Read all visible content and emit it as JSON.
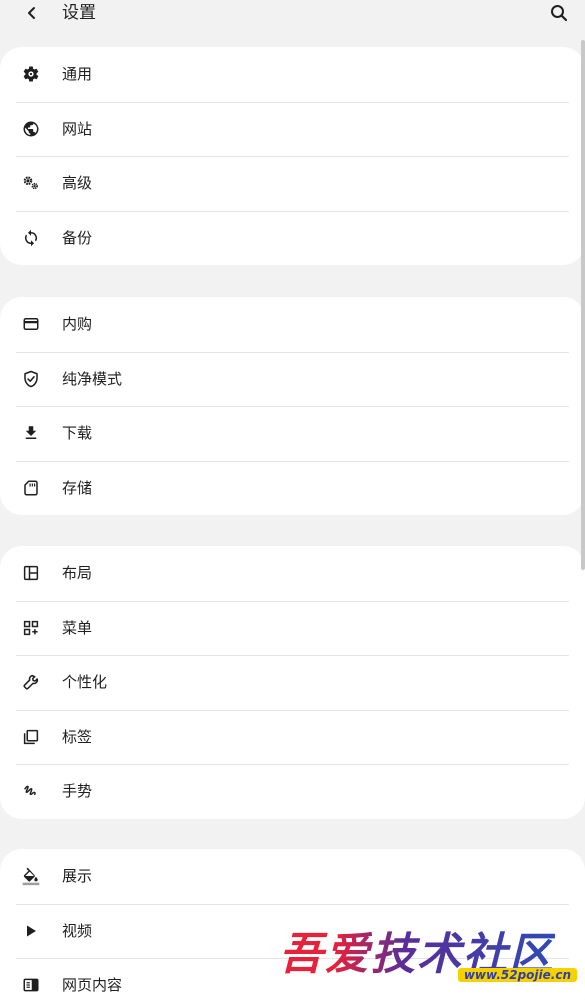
{
  "header": {
    "title": "设置"
  },
  "groups": [
    {
      "items": [
        {
          "label": "通用",
          "icon": "gear-icon"
        },
        {
          "label": "网站",
          "icon": "globe-icon"
        },
        {
          "label": "高级",
          "icon": "gears-icon"
        },
        {
          "label": "备份",
          "icon": "sync-icon"
        }
      ]
    },
    {
      "items": [
        {
          "label": "内购",
          "icon": "credit-card-icon"
        },
        {
          "label": "纯净模式",
          "icon": "shield-check-icon"
        },
        {
          "label": "下载",
          "icon": "download-icon"
        },
        {
          "label": "存储",
          "icon": "sd-card-icon"
        }
      ]
    },
    {
      "items": [
        {
          "label": "布局",
          "icon": "layout-icon"
        },
        {
          "label": "菜单",
          "icon": "add-grid-icon"
        },
        {
          "label": "个性化",
          "icon": "wrench-icon"
        },
        {
          "label": "标签",
          "icon": "tabs-icon"
        },
        {
          "label": "手势",
          "icon": "gesture-icon"
        }
      ]
    },
    {
      "items": [
        {
          "label": "展示",
          "icon": "paint-bucket-icon"
        },
        {
          "label": "视频",
          "icon": "play-icon"
        },
        {
          "label": "网页内容",
          "icon": "web-content-icon"
        }
      ]
    }
  ],
  "watermark": {
    "text": "吾爱技术社区",
    "url": "www.52pojie.cn"
  },
  "colors": {
    "background": "#f2f2f2",
    "card": "#ffffff",
    "text": "#1f1f1f",
    "divider": "#e4e4e4"
  }
}
